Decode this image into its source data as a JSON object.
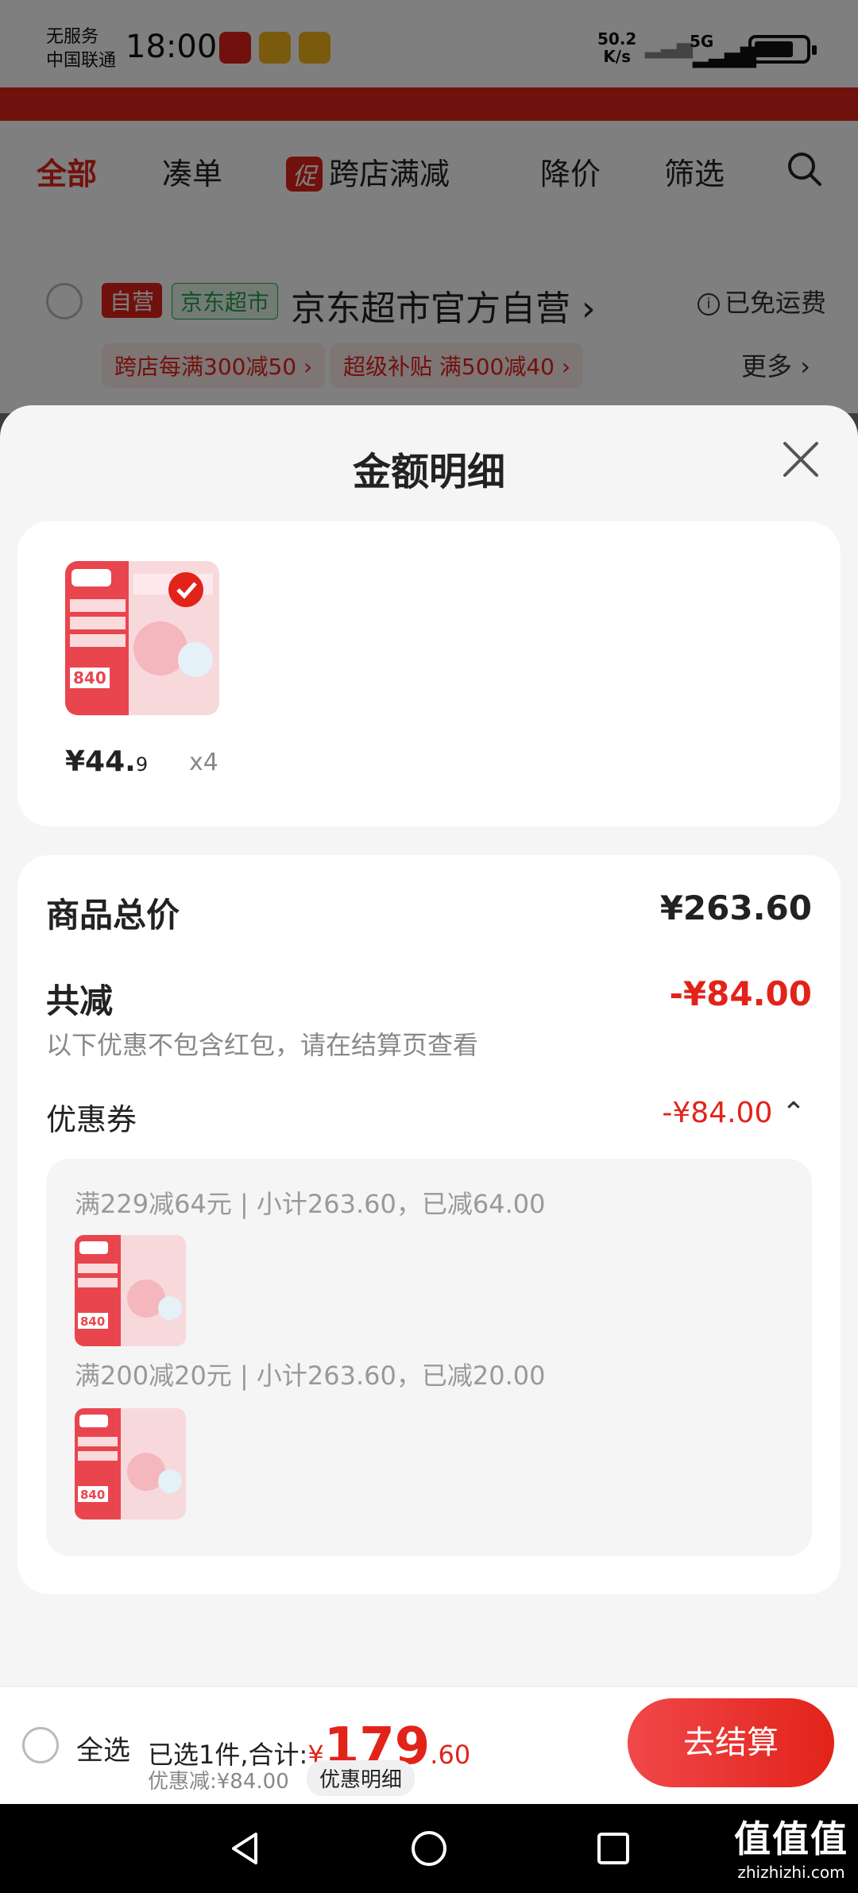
{
  "status_bar": {
    "carrier_line1": "无服务",
    "carrier_line2": "中国联通",
    "time": "18:00",
    "net_speed_value": "50.2",
    "net_speed_unit": "K/s",
    "network": "5G"
  },
  "tabs": {
    "all": "全部",
    "combine": "凑单",
    "promo_badge": "促",
    "cross_store": "跨店满减",
    "price_drop": "降价",
    "filter": "筛选"
  },
  "store": {
    "tag_self": "自营",
    "tag_supermarket": "京东超市",
    "name": "京东超市官方自营",
    "chevron": "›",
    "freeship": "已免运费",
    "promo1": "跨店每满300减50 ›",
    "promo2": "超级补贴 满500减40 ›",
    "more": "更多 ›"
  },
  "sheet": {
    "title": "金额明细",
    "product": {
      "price_main": "¥44.",
      "price_cents": "9",
      "qty": "x4"
    },
    "total_label": "商品总价",
    "total_value": "¥263.60",
    "reduce_label": "共减",
    "reduce_value": "-¥84.00",
    "reduce_note": "以下优惠不包含红包，请在结算页查看",
    "coupon_label": "优惠券",
    "coupon_value": "-¥84.00",
    "coupon_lines": [
      "满229减64元 | 小计263.60，已减64.00",
      "满200减20元 | 小计263.60，已减20.00"
    ]
  },
  "bottom": {
    "select_all": "全选",
    "selected_summary": "已选1件,合计:",
    "yen": "¥",
    "total_int": "179",
    "total_cents": ".60",
    "discount_line": "优惠减:¥84.00",
    "detail_chip": "优惠明细",
    "checkout": "去结算"
  },
  "watermark": {
    "line1": "值值值",
    "line2": "zhizhizhi.com"
  },
  "colors": {
    "accent": "#e2231a",
    "green": "#27a24a"
  }
}
